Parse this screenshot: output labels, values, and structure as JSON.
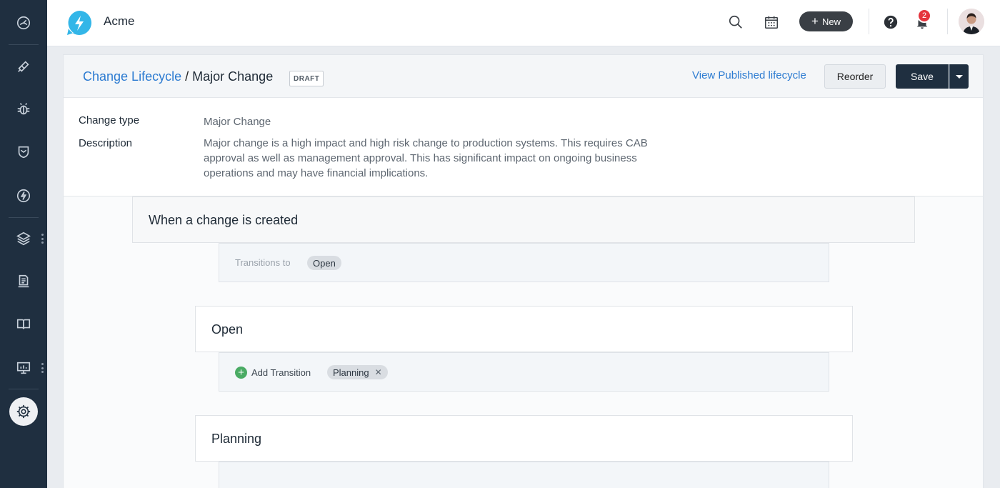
{
  "header": {
    "app_title": "Acme",
    "new_label": "New",
    "notification_count": "2"
  },
  "breadcrumb": {
    "parent": "Change Lifecycle",
    "separator": "/",
    "current": "Major Change",
    "status_badge": "DRAFT"
  },
  "actions": {
    "view_published": "View Published lifecycle",
    "reorder": "Reorder",
    "save": "Save"
  },
  "details": {
    "change_type_label": "Change type",
    "change_type_value": "Major Change",
    "description_label": "Description",
    "description_value": "Major change is a high impact and high risk change to production systems. This requires CAB approval as well as management approval. This has significant impact on ongoing business operations and may have financial implications."
  },
  "flow": {
    "trigger": {
      "title": "When a change is created",
      "transitions_label": "Transitions to",
      "transition_chip": "Open"
    },
    "states": [
      {
        "title": "Open",
        "add_transition_label": "Add Transition",
        "transition_chip": "Planning"
      },
      {
        "title": "Planning"
      }
    ]
  },
  "colors": {
    "sidebar_bg": "#1f2f40",
    "link": "#2c7bd1",
    "primary_button": "#1f2f40",
    "badge": "#e5343d",
    "add_icon": "#4aab64"
  },
  "icons": {
    "sidebar": [
      "dashboard-icon",
      "tickets-icon",
      "problems-icon",
      "changes-icon",
      "releases-icon",
      "assets-icon",
      "contracts-icon",
      "solutions-icon",
      "analytics-icon",
      "admin-settings-icon"
    ],
    "header": [
      "search-icon",
      "calendar-icon",
      "help-icon",
      "bell-icon"
    ]
  }
}
